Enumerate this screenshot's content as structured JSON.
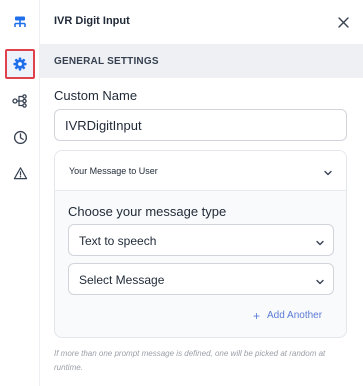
{
  "sidebar": {
    "icons": [
      {
        "name": "flow-icon",
        "active": false
      },
      {
        "name": "gear-icon",
        "active": true
      },
      {
        "name": "branch-icon",
        "active": false
      },
      {
        "name": "clock-icon",
        "active": false
      },
      {
        "name": "warning-icon",
        "active": false
      }
    ]
  },
  "panel": {
    "title": "IVR Digit Input",
    "section_title": "GENERAL SETTINGS",
    "custom_name": {
      "label": "Custom Name",
      "value": "IVRDigitInput"
    },
    "message_card": {
      "title": "Your Message to User",
      "type_label": "Choose your message type",
      "type_select": {
        "value": "Text to speech"
      },
      "message_select": {
        "value": "Select Message"
      },
      "add_another_label": "Add Another"
    },
    "footnote": "If more than one prompt message is defined, one will be picked at random at runtime."
  },
  "colors": {
    "accent": "#1f6feb",
    "highlight_border": "#e0414f",
    "link": "#5b7bd5",
    "section_bg": "#eef0f3"
  }
}
